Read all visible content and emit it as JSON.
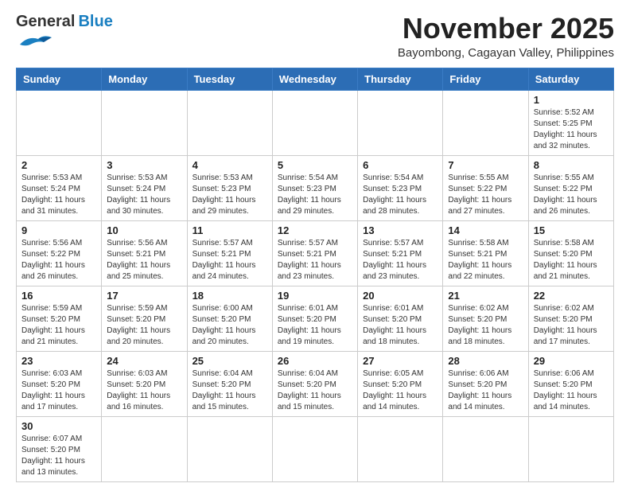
{
  "header": {
    "logo_general": "General",
    "logo_blue": "Blue",
    "month_title": "November 2025",
    "location": "Bayombong, Cagayan Valley, Philippines"
  },
  "weekdays": [
    "Sunday",
    "Monday",
    "Tuesday",
    "Wednesday",
    "Thursday",
    "Friday",
    "Saturday"
  ],
  "days": {
    "d1": {
      "num": "1",
      "sunrise": "Sunrise: 5:52 AM",
      "sunset": "Sunset: 5:25 PM",
      "daylight": "Daylight: 11 hours and 32 minutes."
    },
    "d2": {
      "num": "2",
      "sunrise": "Sunrise: 5:53 AM",
      "sunset": "Sunset: 5:24 PM",
      "daylight": "Daylight: 11 hours and 31 minutes."
    },
    "d3": {
      "num": "3",
      "sunrise": "Sunrise: 5:53 AM",
      "sunset": "Sunset: 5:24 PM",
      "daylight": "Daylight: 11 hours and 30 minutes."
    },
    "d4": {
      "num": "4",
      "sunrise": "Sunrise: 5:53 AM",
      "sunset": "Sunset: 5:23 PM",
      "daylight": "Daylight: 11 hours and 29 minutes."
    },
    "d5": {
      "num": "5",
      "sunrise": "Sunrise: 5:54 AM",
      "sunset": "Sunset: 5:23 PM",
      "daylight": "Daylight: 11 hours and 29 minutes."
    },
    "d6": {
      "num": "6",
      "sunrise": "Sunrise: 5:54 AM",
      "sunset": "Sunset: 5:23 PM",
      "daylight": "Daylight: 11 hours and 28 minutes."
    },
    "d7": {
      "num": "7",
      "sunrise": "Sunrise: 5:55 AM",
      "sunset": "Sunset: 5:22 PM",
      "daylight": "Daylight: 11 hours and 27 minutes."
    },
    "d8": {
      "num": "8",
      "sunrise": "Sunrise: 5:55 AM",
      "sunset": "Sunset: 5:22 PM",
      "daylight": "Daylight: 11 hours and 26 minutes."
    },
    "d9": {
      "num": "9",
      "sunrise": "Sunrise: 5:56 AM",
      "sunset": "Sunset: 5:22 PM",
      "daylight": "Daylight: 11 hours and 26 minutes."
    },
    "d10": {
      "num": "10",
      "sunrise": "Sunrise: 5:56 AM",
      "sunset": "Sunset: 5:21 PM",
      "daylight": "Daylight: 11 hours and 25 minutes."
    },
    "d11": {
      "num": "11",
      "sunrise": "Sunrise: 5:57 AM",
      "sunset": "Sunset: 5:21 PM",
      "daylight": "Daylight: 11 hours and 24 minutes."
    },
    "d12": {
      "num": "12",
      "sunrise": "Sunrise: 5:57 AM",
      "sunset": "Sunset: 5:21 PM",
      "daylight": "Daylight: 11 hours and 23 minutes."
    },
    "d13": {
      "num": "13",
      "sunrise": "Sunrise: 5:57 AM",
      "sunset": "Sunset: 5:21 PM",
      "daylight": "Daylight: 11 hours and 23 minutes."
    },
    "d14": {
      "num": "14",
      "sunrise": "Sunrise: 5:58 AM",
      "sunset": "Sunset: 5:21 PM",
      "daylight": "Daylight: 11 hours and 22 minutes."
    },
    "d15": {
      "num": "15",
      "sunrise": "Sunrise: 5:58 AM",
      "sunset": "Sunset: 5:20 PM",
      "daylight": "Daylight: 11 hours and 21 minutes."
    },
    "d16": {
      "num": "16",
      "sunrise": "Sunrise: 5:59 AM",
      "sunset": "Sunset: 5:20 PM",
      "daylight": "Daylight: 11 hours and 21 minutes."
    },
    "d17": {
      "num": "17",
      "sunrise": "Sunrise: 5:59 AM",
      "sunset": "Sunset: 5:20 PM",
      "daylight": "Daylight: 11 hours and 20 minutes."
    },
    "d18": {
      "num": "18",
      "sunrise": "Sunrise: 6:00 AM",
      "sunset": "Sunset: 5:20 PM",
      "daylight": "Daylight: 11 hours and 20 minutes."
    },
    "d19": {
      "num": "19",
      "sunrise": "Sunrise: 6:01 AM",
      "sunset": "Sunset: 5:20 PM",
      "daylight": "Daylight: 11 hours and 19 minutes."
    },
    "d20": {
      "num": "20",
      "sunrise": "Sunrise: 6:01 AM",
      "sunset": "Sunset: 5:20 PM",
      "daylight": "Daylight: 11 hours and 18 minutes."
    },
    "d21": {
      "num": "21",
      "sunrise": "Sunrise: 6:02 AM",
      "sunset": "Sunset: 5:20 PM",
      "daylight": "Daylight: 11 hours and 18 minutes."
    },
    "d22": {
      "num": "22",
      "sunrise": "Sunrise: 6:02 AM",
      "sunset": "Sunset: 5:20 PM",
      "daylight": "Daylight: 11 hours and 17 minutes."
    },
    "d23": {
      "num": "23",
      "sunrise": "Sunrise: 6:03 AM",
      "sunset": "Sunset: 5:20 PM",
      "daylight": "Daylight: 11 hours and 17 minutes."
    },
    "d24": {
      "num": "24",
      "sunrise": "Sunrise: 6:03 AM",
      "sunset": "Sunset: 5:20 PM",
      "daylight": "Daylight: 11 hours and 16 minutes."
    },
    "d25": {
      "num": "25",
      "sunrise": "Sunrise: 6:04 AM",
      "sunset": "Sunset: 5:20 PM",
      "daylight": "Daylight: 11 hours and 15 minutes."
    },
    "d26": {
      "num": "26",
      "sunrise": "Sunrise: 6:04 AM",
      "sunset": "Sunset: 5:20 PM",
      "daylight": "Daylight: 11 hours and 15 minutes."
    },
    "d27": {
      "num": "27",
      "sunrise": "Sunrise: 6:05 AM",
      "sunset": "Sunset: 5:20 PM",
      "daylight": "Daylight: 11 hours and 14 minutes."
    },
    "d28": {
      "num": "28",
      "sunrise": "Sunrise: 6:06 AM",
      "sunset": "Sunset: 5:20 PM",
      "daylight": "Daylight: 11 hours and 14 minutes."
    },
    "d29": {
      "num": "29",
      "sunrise": "Sunrise: 6:06 AM",
      "sunset": "Sunset: 5:20 PM",
      "daylight": "Daylight: 11 hours and 14 minutes."
    },
    "d30": {
      "num": "30",
      "sunrise": "Sunrise: 6:07 AM",
      "sunset": "Sunset: 5:20 PM",
      "daylight": "Daylight: 11 hours and 13 minutes."
    }
  }
}
